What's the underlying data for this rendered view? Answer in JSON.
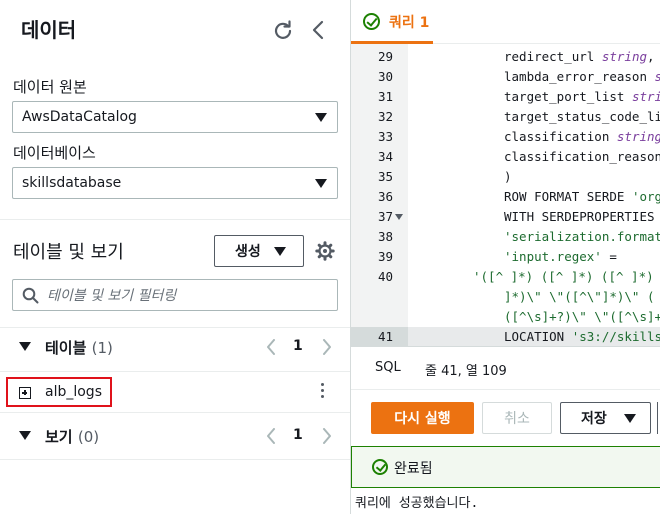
{
  "data_panel": {
    "title": "데이터",
    "refresh_icon": "refresh-icon",
    "collapse_icon": "chevron-left-icon",
    "data_source_label": "데이터 원본",
    "data_source_value": "AwsDataCatalog",
    "database_label": "데이터베이스",
    "database_value": "skillsdatabase",
    "tables_views_title": "테이블 및 보기",
    "create_button": "생성",
    "settings_icon": "gear-icon",
    "filter_placeholder": "테이블 및 보기 필터링",
    "tables_section": {
      "label": "테이블",
      "count": "(1)",
      "page": "1"
    },
    "tables": [
      {
        "name": "alb_logs"
      }
    ],
    "views_section": {
      "label": "보기",
      "count": "(0)",
      "page": "1"
    }
  },
  "query_panel": {
    "tab_label": "쿼리 1",
    "code_lines": [
      {
        "num": "29",
        "fold": false,
        "indent": "ind2",
        "parts": [
          [
            "",
            "redirect_url "
          ],
          [
            "ty",
            "string"
          ],
          [
            "",
            ","
          ]
        ]
      },
      {
        "num": "30",
        "fold": false,
        "indent": "ind2",
        "parts": [
          [
            "",
            "lambda_error_reason "
          ],
          [
            "ty",
            "s"
          ]
        ]
      },
      {
        "num": "31",
        "fold": false,
        "indent": "ind2",
        "parts": [
          [
            "",
            "target_port_list "
          ],
          [
            "ty",
            "stri"
          ]
        ]
      },
      {
        "num": "32",
        "fold": false,
        "indent": "ind2",
        "parts": [
          [
            "",
            "target_status_code_li"
          ]
        ]
      },
      {
        "num": "33",
        "fold": false,
        "indent": "ind2",
        "parts": [
          [
            "",
            "classification "
          ],
          [
            "ty",
            "string"
          ]
        ]
      },
      {
        "num": "34",
        "fold": false,
        "indent": "ind2",
        "parts": [
          [
            "",
            "classification_reason"
          ]
        ]
      },
      {
        "num": "35",
        "fold": false,
        "indent": "ind2",
        "parts": [
          [
            "",
            ")"
          ]
        ]
      },
      {
        "num": "36",
        "fold": false,
        "indent": "ind2",
        "parts": [
          [
            "",
            "ROW FORMAT SERDE "
          ],
          [
            "str",
            "'org"
          ]
        ]
      },
      {
        "num": "37",
        "fold": true,
        "indent": "ind2",
        "parts": [
          [
            "",
            "WITH SERDEPROPERTIES"
          ]
        ]
      },
      {
        "num": "38",
        "fold": false,
        "indent": "ind2",
        "parts": [
          [
            "str",
            "'serialization.format"
          ]
        ]
      },
      {
        "num": "39",
        "fold": false,
        "indent": "ind2",
        "parts": [
          [
            "str",
            "'input.regex'"
          ],
          [
            "",
            " ="
          ]
        ]
      },
      {
        "num": "40",
        "fold": false,
        "indent": "ind1",
        "parts": [
          [
            "str",
            "'([^ ]*) ([^ ]*) ([^ ]*)"
          ]
        ]
      },
      {
        "num": "",
        "fold": false,
        "indent": "ind2",
        "parts": [
          [
            "str",
            "]*)\\\" \\\"([^\\\"]*)\\\" ("
          ]
        ]
      },
      {
        "num": "",
        "fold": false,
        "indent": "ind2",
        "parts": [
          [
            "str",
            "([^\\s]+?)\\\" \\\"([^\\s]+"
          ]
        ]
      },
      {
        "num": "41",
        "fold": false,
        "indent": "ind2",
        "active": true,
        "parts": [
          [
            "",
            "LOCATION "
          ],
          [
            "str",
            "'s3://skills"
          ]
        ]
      }
    ],
    "status": {
      "lang": "SQL",
      "position": "줄 41, 열 109"
    },
    "run_button": "다시 실행",
    "cancel_button": "취소",
    "save_button": "저장",
    "result_status": "완료됨",
    "result_message": "쿼리에 성공했습니다."
  }
}
